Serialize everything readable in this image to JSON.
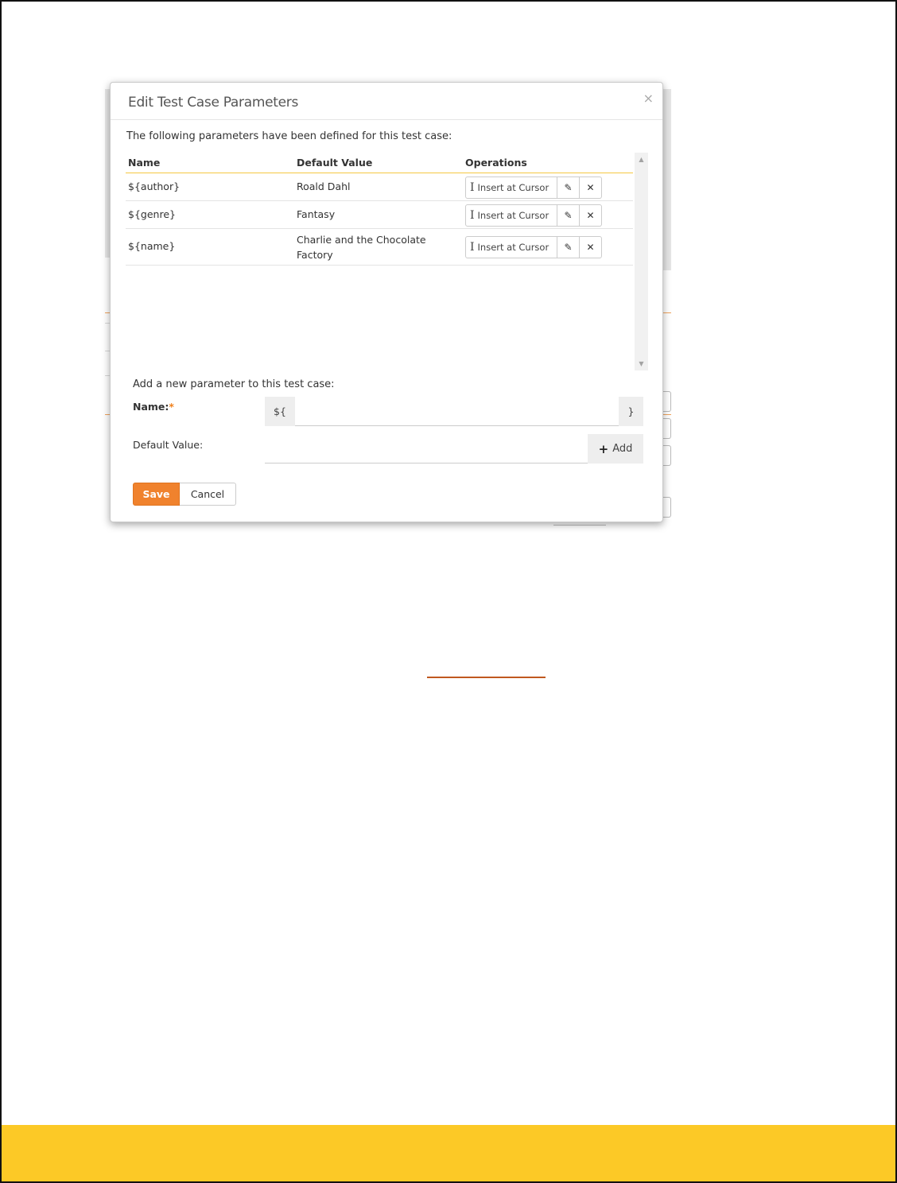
{
  "modal": {
    "title": "Edit Test Case Parameters",
    "close_glyph": "×",
    "intro": "The following parameters have been defined for this test case:",
    "columns": [
      "Name",
      "Default Value",
      "Operations"
    ],
    "rows": [
      {
        "name": "${author}",
        "default": "Roald Dahl"
      },
      {
        "name": "${genre}",
        "default": "Fantasy"
      },
      {
        "name": "${name}",
        "default": "Charlie and the Chocolate Factory"
      }
    ],
    "insert_label": "Insert at Cursor",
    "icons": {
      "insert": "text-cursor-icon",
      "edit": "edit-icon",
      "delete": "delete-x-icon",
      "scroll_up": "scroll-up-icon",
      "scroll_down": "scroll-down-icon",
      "add": "plus-icon"
    },
    "add_section": {
      "label": "Add a new parameter to this test case:",
      "name_label": "Name:",
      "required_mark": "*",
      "prefix": "${",
      "suffix": "}",
      "name_value": "",
      "default_label": "Default Value:",
      "default_value": "",
      "add_label": "Add"
    },
    "save_label": "Save",
    "cancel_label": "Cancel"
  },
  "colors": {
    "accent": "#f0822d",
    "footer_band": "#fcc926",
    "header_rule": "#f5c842",
    "orange_rule": "#c0581f"
  }
}
